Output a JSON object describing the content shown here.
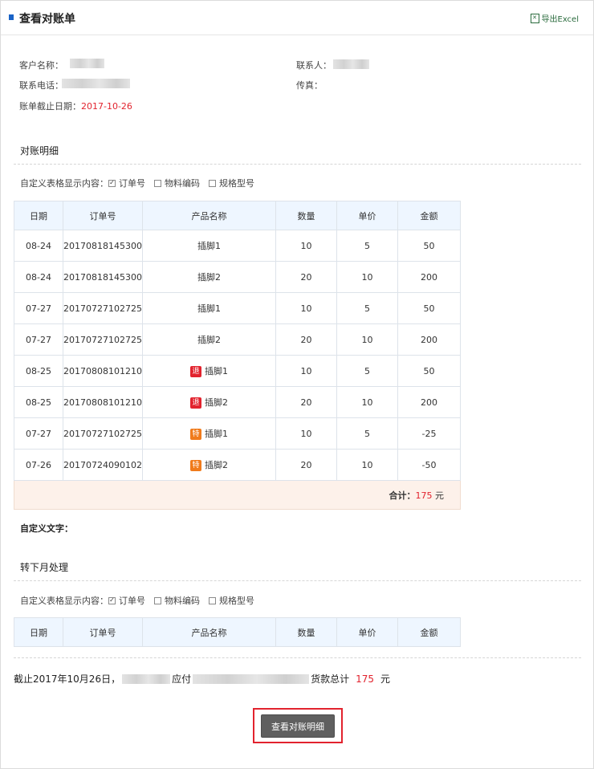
{
  "header": {
    "title": "查看对账单",
    "export_label": "导出Excel",
    "export_icon": "excel-icon"
  },
  "info": {
    "customer_label": "客户名称：",
    "contact_label": "联系人：",
    "phone_label": "联系电话：",
    "fax_label": "传真：",
    "deadline_label": "账单截止日期：",
    "deadline_value": "2017-10-26"
  },
  "details": {
    "section_title": "对账明细",
    "options_label": "自定义表格显示内容：",
    "options": [
      {
        "label": "订单号",
        "checked": true
      },
      {
        "label": "物料编码",
        "checked": false
      },
      {
        "label": "规格型号",
        "checked": false
      }
    ],
    "columns": [
      "日期",
      "订单号",
      "产品名称",
      "数量",
      "单价",
      "金额"
    ],
    "rows": [
      {
        "date": "08-24",
        "order": "20170818145300",
        "tag": "",
        "product": "插脚1",
        "qty": "10",
        "price": "5",
        "amount": "50"
      },
      {
        "date": "08-24",
        "order": "20170818145300",
        "tag": "",
        "product": "插脚2",
        "qty": "20",
        "price": "10",
        "amount": "200"
      },
      {
        "date": "07-27",
        "order": "20170727102725",
        "tag": "",
        "product": "插脚1",
        "qty": "10",
        "price": "5",
        "amount": "50"
      },
      {
        "date": "07-27",
        "order": "20170727102725",
        "tag": "",
        "product": "插脚2",
        "qty": "20",
        "price": "10",
        "amount": "200"
      },
      {
        "date": "08-25",
        "order": "20170808101210",
        "tag": "退",
        "product": "插脚1",
        "qty": "10",
        "price": "5",
        "amount": "50"
      },
      {
        "date": "08-25",
        "order": "20170808101210",
        "tag": "退",
        "product": "插脚2",
        "qty": "20",
        "price": "10",
        "amount": "200"
      },
      {
        "date": "07-27",
        "order": "20170727102725",
        "tag": "特",
        "product": "插脚1",
        "qty": "10",
        "price": "5",
        "amount": "-25"
      },
      {
        "date": "07-26",
        "order": "20170724090102",
        "tag": "特",
        "product": "插脚2",
        "qty": "20",
        "price": "10",
        "amount": "-50"
      }
    ],
    "total_label": "合计：",
    "total_value": "175",
    "total_unit": " 元"
  },
  "custom_text_label": "自定义文字：",
  "carry": {
    "section_title": "转下月处理",
    "options_label": "自定义表格显示内容：",
    "options": [
      {
        "label": "订单号",
        "checked": true
      },
      {
        "label": "物料编码",
        "checked": false
      },
      {
        "label": "规格型号",
        "checked": false
      }
    ],
    "columns": [
      "日期",
      "订单号",
      "产品名称",
      "数量",
      "单价",
      "金额"
    ]
  },
  "summary": {
    "prefix": "截止2017年10月26日，",
    "pay_text": "应付",
    "total_text": "货款总计",
    "amount": "175",
    "unit": "元"
  },
  "actions": {
    "view_details_label": "查看对账明细"
  },
  "colors": {
    "accent_blue": "#1a63c7",
    "highlight_red": "#e2232e",
    "special_orange": "#f07b1c"
  }
}
